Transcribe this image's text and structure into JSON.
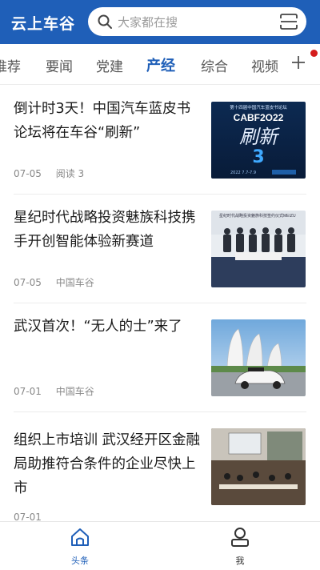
{
  "header": {
    "app_title": "云上车谷",
    "search_placeholder": "大家都在搜"
  },
  "tabs": [
    {
      "label": "推荐",
      "active": false
    },
    {
      "label": "要闻",
      "active": false
    },
    {
      "label": "党建",
      "active": false
    },
    {
      "label": "产经",
      "active": true
    },
    {
      "label": "综合",
      "active": false
    },
    {
      "label": "视频",
      "active": false
    }
  ],
  "news": [
    {
      "title": "倒计时3天！中国汽车蓝皮书论坛将在车谷“刷新”",
      "date": "07-05",
      "extra": "阅读 3"
    },
    {
      "title": "星纪时代战略投资魅族科技携手开创智能体验新赛道",
      "date": "07-05",
      "extra": "中国车谷"
    },
    {
      "title": "武汉首次！“无人的士”来了",
      "date": "07-01",
      "extra": "中国车谷"
    },
    {
      "title": "组织上市培训 武汉经开区金融局助推符合条件的企业尽快上市",
      "date": "07-01",
      "extra": ""
    }
  ],
  "thumbs": {
    "t1_header": "第十四届中国汽车蓝皮书论坛",
    "t1_code": "CABF2O22",
    "t1_big": "刷新",
    "t1_num": "3",
    "t1_date": "2022 7.7-7.9",
    "t2_top": "星纪时代战略投资魅族科技签约仪式",
    "t2_brand": "MEIZU"
  },
  "bottom_nav": [
    {
      "label": "头条",
      "active": true
    },
    {
      "label": "我",
      "active": false
    }
  ],
  "colors": {
    "brand": "#1f5fb8",
    "badge": "#d41c1c"
  }
}
